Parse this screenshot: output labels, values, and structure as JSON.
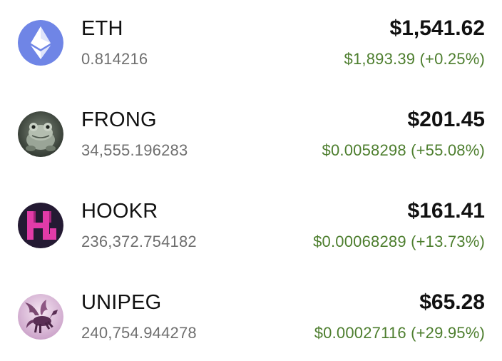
{
  "tokens": [
    {
      "symbol": "ETH",
      "balance": "0.814216",
      "value": "$1,541.62",
      "price_change": "$1,893.39 (+0.25%)",
      "icon": "ethereum-logo"
    },
    {
      "symbol": "FRONG",
      "balance": "34,555.196283",
      "value": "$201.45",
      "price_change": "$0.0058298 (+55.08%)",
      "icon": "frog-avatar"
    },
    {
      "symbol": "HOOKR",
      "balance": "236,372.754182",
      "value": "$161.41",
      "price_change": "$0.00068289 (+13.73%)",
      "icon": "hookr-logo"
    },
    {
      "symbol": "UNIPEG",
      "balance": "240,754.944278",
      "value": "$65.28",
      "price_change": "$0.00027116 (+29.95%)",
      "icon": "pegasus-avatar"
    }
  ],
  "colors": {
    "positive_change": "#4d7e2e",
    "eth_blue": "#6f85e6"
  }
}
